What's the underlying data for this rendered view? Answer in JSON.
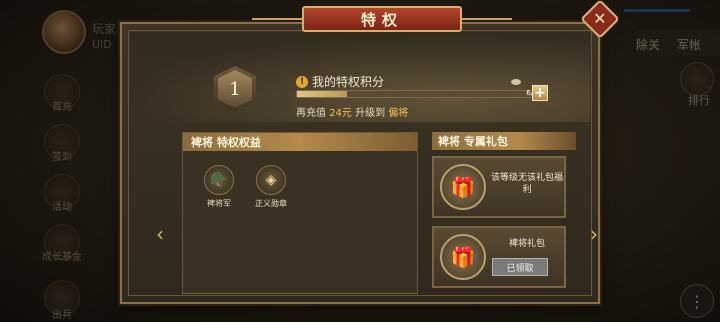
{
  "background": {
    "player_name": "玩家",
    "uid_label": "UID",
    "side_buttons": [
      "首充",
      "签到",
      "活动",
      "成长基金",
      "出兵"
    ],
    "right_tabs": [
      "除关",
      "军帐"
    ],
    "right_label": "排行"
  },
  "modal": {
    "title": "特权",
    "rank_number": "1",
    "score_title": "我的特权积分",
    "progress_text": "6/30",
    "progress_value": 0.2,
    "recharge_prefix": "再充值",
    "recharge_amount": "24元",
    "upgrade_prefix": "升级到",
    "upgrade_target": "偏将",
    "left_panel_title": "裨将 特权权益",
    "perks": [
      {
        "label": "裨将军",
        "icon": "helmet-icon"
      },
      {
        "label": "正义勋章",
        "icon": "medal-icon"
      }
    ],
    "right_panel_title": "裨将 专属礼包",
    "gift_cards": [
      {
        "text": "该等级无该礼包福利"
      },
      {
        "title": "裨将礼包",
        "button": "已领取"
      }
    ]
  },
  "icons": {
    "close": "close-icon",
    "plus": "plus-icon",
    "warning": "warning-icon",
    "left_arrow": "chevron-left-icon",
    "right_arrow": "chevron-right-icon",
    "menu": "menu-icon"
  }
}
